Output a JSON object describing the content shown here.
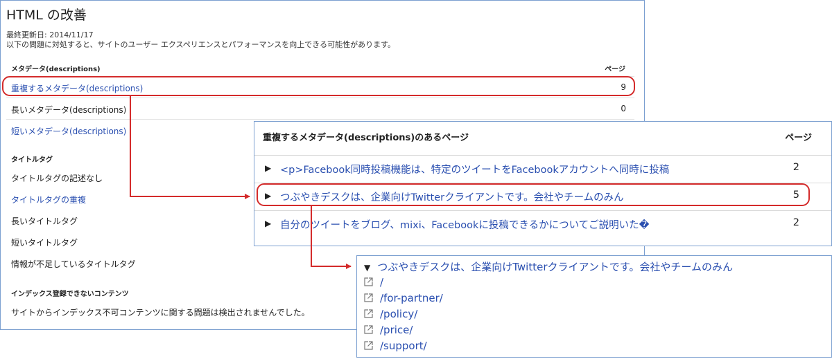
{
  "main": {
    "title": "HTML の改善",
    "last_updated": "最終更新日: 2014/11/17",
    "description": "以下の問題に対処すると、サイトのユーザー エクスペリエンスとパフォーマンスを向上できる可能性があります。",
    "meta_section": {
      "heading": "メタデータ(descriptions)",
      "col_header": "ページ",
      "rows": [
        {
          "label": "重複するメタデータ(descriptions)",
          "count": "9"
        },
        {
          "label": "長いメタデータ(descriptions)",
          "count": "0"
        },
        {
          "label": "短いメタデータ(descriptions)",
          "count": ""
        }
      ]
    },
    "title_section": {
      "heading": "タイトルタグ",
      "rows": [
        {
          "label": "タイトルタグの記述なし"
        },
        {
          "label": "タイトルタグの重複"
        },
        {
          "label": "長いタイトルタグ"
        },
        {
          "label": "短いタイトルタグ"
        },
        {
          "label": "情報が不足しているタイトルタグ"
        }
      ]
    },
    "nonindex_section": {
      "heading": "インデックス登録できないコンテンツ",
      "message": "サイトからインデックス不可コンテンツに関する問題は検出されませんでした。"
    }
  },
  "popup": {
    "heading": "重複するメタデータ(descriptions)のあるページ",
    "col_header": "ページ",
    "rows": [
      {
        "label": "<p>Facebook同時投稿機能は、特定のツイートをFacebookアカウントへ同時に投稿",
        "count": "2"
      },
      {
        "label": "つぶやきデスクは、企業向けTwitterクライアントです。会社やチームのみん",
        "count": "5"
      },
      {
        "label": "自分のツイートをブログ、mixi、Facebookに投稿できるかについてご説明いた�",
        "count": "2"
      }
    ]
  },
  "urls": {
    "heading": "つぶやきデスクは、企業向けTwitterクライアントです。会社やチームのみん",
    "items": [
      "/",
      "/for-partner/",
      "/policy/",
      "/price/",
      "/support/"
    ]
  },
  "colors": {
    "link": "#2a4fb0",
    "highlight": "#d42b2b",
    "border": "#7b9fd0"
  },
  "icons": {
    "expand": "triangle-right-icon",
    "collapse": "triangle-down-icon",
    "external": "external-link-icon"
  }
}
